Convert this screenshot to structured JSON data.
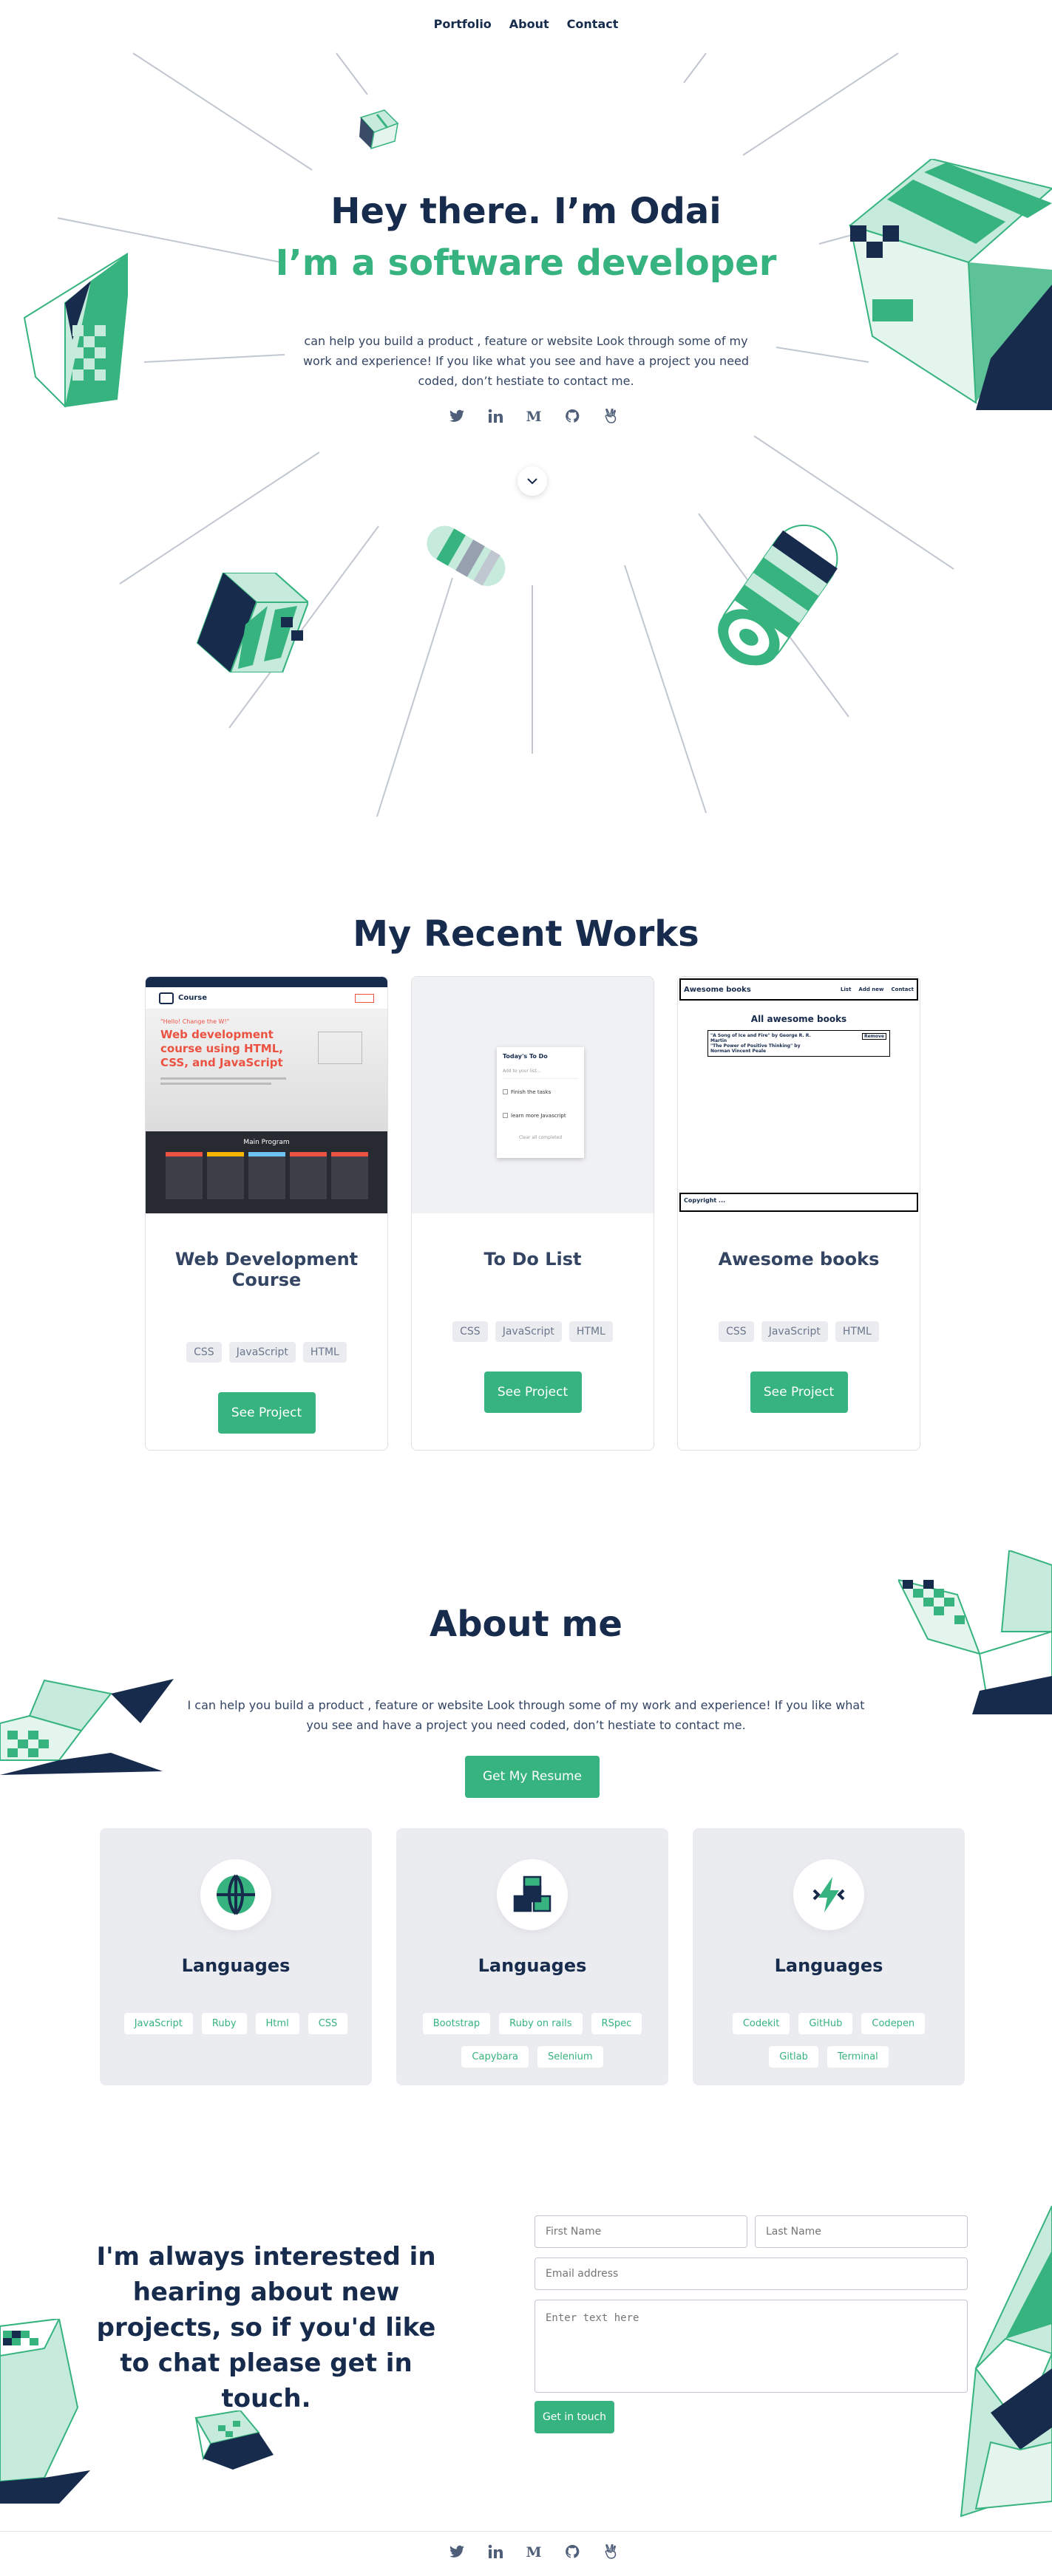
{
  "nav": {
    "items": [
      "Portfolio",
      "About",
      "Contact"
    ]
  },
  "hero": {
    "title": "Hey there. I’m Odai",
    "subtitle": "I’m a software developer",
    "text": "can help you build a product , feature or website Look through some of my work and experience! If you like what you see and have a project you need coded, don’t hestiate to contact me."
  },
  "socials": [
    "twitter-icon",
    "linkedin-icon",
    "medium-icon",
    "github-icon",
    "angellist-icon"
  ],
  "works": {
    "title": "My Recent Works",
    "cards": [
      {
        "title": "Web Development Course",
        "tags": [
          "CSS",
          "JavaScript",
          "HTML"
        ],
        "button": "See Project",
        "preview": {
          "brand": "Course",
          "tagline": "\"Hello! Change the W!\"",
          "headline": "Web development course using HTML, CSS, and JavaScript",
          "section": "Main Program"
        }
      },
      {
        "title": "To Do List",
        "tags": [
          "CSS",
          "JavaScript",
          "HTML"
        ],
        "button": "See Project",
        "preview": {
          "app_title": "Today's To Do",
          "placeholder": "Add to your list...",
          "items": [
            "Finish the tasks",
            "learn more Javascript"
          ],
          "footer": "Clear all completed"
        }
      },
      {
        "title": "Awesome books",
        "tags": [
          "CSS",
          "JavaScript",
          "HTML"
        ],
        "button": "See Project",
        "preview": {
          "brand": "Awesome books",
          "links": [
            "List",
            "Add new",
            "Contact"
          ],
          "heading": "All awesome books",
          "book1": "\"A Song of Ice and Fire\" by George R. R. Martin",
          "book2": "\"The Power of Positive Thinking\" by Norman Vincent Peale",
          "remove": "Remove",
          "footer": "Copyright ..."
        }
      }
    ]
  },
  "about": {
    "title": "About me",
    "text": "I can help you build a product , feature or website Look through some of my work and experience! If you like what you see and have a project you need coded, don’t hestiate to contact me.",
    "button": "Get My Resume",
    "cards": [
      {
        "title": "Languages",
        "icon": "globe-icon",
        "tags": [
          "JavaScript",
          "Ruby",
          "Html",
          "CSS"
        ]
      },
      {
        "title": "Languages",
        "icon": "cubes-icon",
        "tags": [
          "Bootstrap",
          "Ruby on rails",
          "RSpec",
          "Capybara",
          "Selenium"
        ]
      },
      {
        "title": "Languages",
        "icon": "lightning-icon",
        "tags": [
          "Codekit",
          "GitHub",
          "Codepen",
          "Gitlab",
          "Terminal"
        ]
      }
    ]
  },
  "contact": {
    "heading": "I'm always interested in hearing about new projects, so if you'd like to chat please get in touch.",
    "first_name": "First Name",
    "last_name": "Last Name",
    "email": "Email address",
    "message": "Enter text here",
    "button": "Get in touch"
  },
  "colors": {
    "navy": "#172b4d",
    "green": "#36b37e",
    "mint": "#c6ebdc"
  }
}
